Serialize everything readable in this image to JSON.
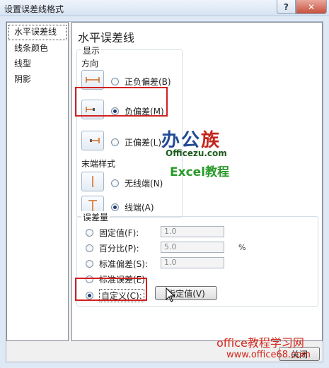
{
  "window": {
    "title": "设置误差线格式",
    "help_label": "?",
    "close_label": "✕"
  },
  "nav": {
    "items": [
      "水平误差线",
      "线条颜色",
      "线型",
      "阴影"
    ]
  },
  "panel": {
    "title": "水平误差线",
    "display": {
      "group_label": "显示",
      "direction_label": "方向",
      "options": [
        {
          "label": "正负偏差(B)",
          "checked": false
        },
        {
          "label": "负偏差(M)",
          "checked": true
        },
        {
          "label": "正偏差(L)",
          "checked": false
        }
      ],
      "end_style_label": "末端样式",
      "end_options": [
        {
          "label": "无线端(N)",
          "checked": false
        },
        {
          "label": "线端(A)",
          "checked": true
        }
      ]
    },
    "error_amount": {
      "group_label": "误差量",
      "options": [
        {
          "label": "固定值(F):",
          "value": "1.0",
          "checked": false
        },
        {
          "label": "百分比(P):",
          "value": "5.0",
          "unit": "%",
          "checked": false
        },
        {
          "label": "标准偏差(S):",
          "value": "1.0",
          "checked": false
        },
        {
          "label": "标准误差(E)",
          "checked": false
        },
        {
          "label": "自定义(C):",
          "checked": true
        }
      ],
      "specify_button": "指定值(V)"
    }
  },
  "footer": {
    "close_button": "关闭"
  },
  "watermark": {
    "logo_blue": "办公",
    "logo_red": "族",
    "site": "Officezu.com",
    "excel_tag": "Excel教程",
    "bottom_title": "office教程学习网",
    "bottom_url": "www.office68.com"
  },
  "colors": {
    "highlight_box": "#d22020",
    "radio_dot": "#1c3e74"
  }
}
